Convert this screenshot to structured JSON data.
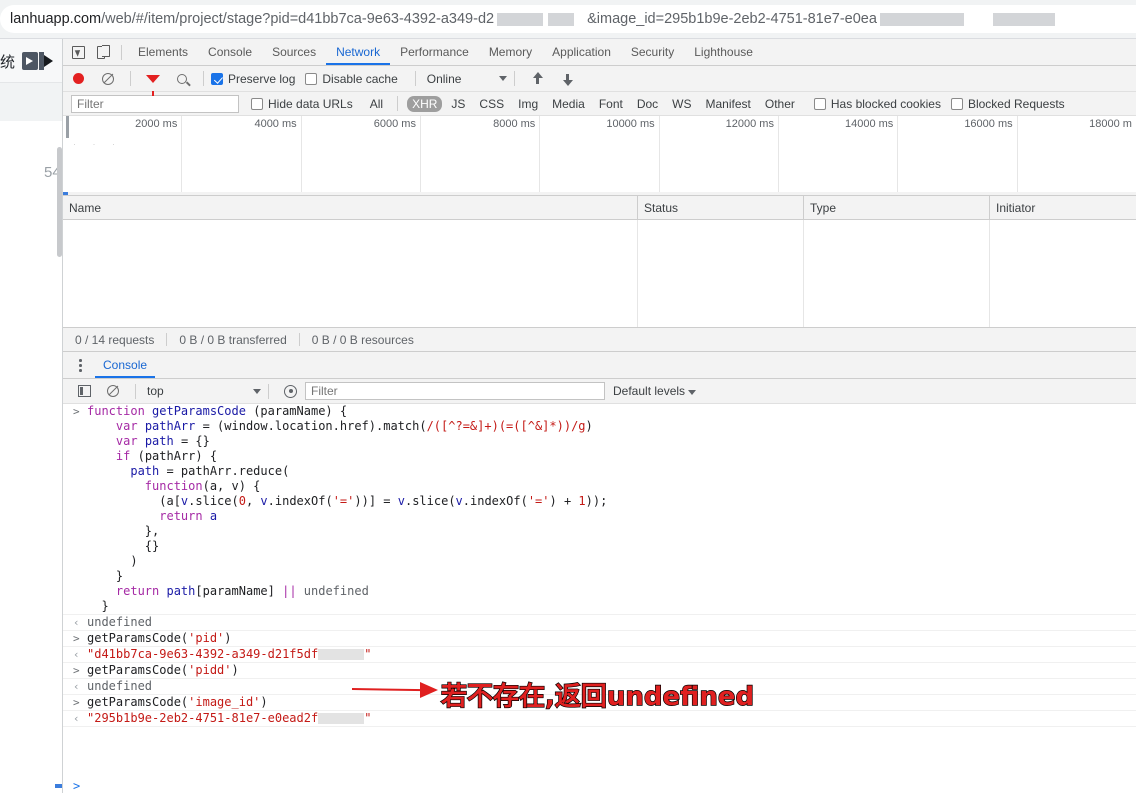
{
  "browser": {
    "url_prefix": "lanhuapp.com",
    "url_path": "/web/#/item/project/stage?pid=d41bb7ca-9e63-4392-a349-d2",
    "url_middle": "&image_id=295b1b9e-2eb2-4751-81e7-e0ea"
  },
  "page_behind": {
    "cn_fragment": "统",
    "line_number": "54"
  },
  "devtools": {
    "tabs": [
      {
        "label": "Elements",
        "active": false
      },
      {
        "label": "Console",
        "active": false
      },
      {
        "label": "Sources",
        "active": false
      },
      {
        "label": "Network",
        "active": true
      },
      {
        "label": "Performance",
        "active": false
      },
      {
        "label": "Memory",
        "active": false
      },
      {
        "label": "Application",
        "active": false
      },
      {
        "label": "Security",
        "active": false
      },
      {
        "label": "Lighthouse",
        "active": false
      }
    ],
    "icons": {
      "inspect": "inspect-element-icon",
      "device": "device-toolbar-icon"
    }
  },
  "network_toolbar": {
    "record_label": "record-button",
    "clear_label": "clear-button",
    "filter_label": "filter-button",
    "search_label": "search-button",
    "preserve_log": {
      "label": "Preserve log",
      "checked": true
    },
    "disable_cache": {
      "label": "Disable cache",
      "checked": false
    },
    "throttling": "Online",
    "import_label": "import-har-button",
    "export_label": "export-har-button"
  },
  "filter_row": {
    "filter_placeholder": "Filter",
    "filter_value": "",
    "hide_data_urls": {
      "label": "Hide data URLs",
      "checked": false
    },
    "types": [
      {
        "label": "All",
        "selected": false
      },
      {
        "label": "XHR",
        "selected": true
      },
      {
        "label": "JS",
        "selected": false
      },
      {
        "label": "CSS",
        "selected": false
      },
      {
        "label": "Img",
        "selected": false
      },
      {
        "label": "Media",
        "selected": false
      },
      {
        "label": "Font",
        "selected": false
      },
      {
        "label": "Doc",
        "selected": false
      },
      {
        "label": "WS",
        "selected": false
      },
      {
        "label": "Manifest",
        "selected": false
      },
      {
        "label": "Other",
        "selected": false
      }
    ],
    "has_blocked_cookies": {
      "label": "Has blocked cookies",
      "checked": false
    },
    "blocked_requests": {
      "label": "Blocked Requests",
      "checked": false
    }
  },
  "overview": {
    "ticks": [
      "2000 ms",
      "4000 ms",
      "6000 ms",
      "8000 ms",
      "10000 ms",
      "12000 ms",
      "14000 ms",
      "16000 ms",
      "18000 m"
    ]
  },
  "network_table": {
    "columns": [
      "Name",
      "Status",
      "Type",
      "Initiator"
    ],
    "rows": []
  },
  "network_status": {
    "requests": "0 / 14 requests",
    "transferred": "0 B / 0 B transferred",
    "resources": "0 B / 0 B resources"
  },
  "drawer": {
    "tab_label": "Console",
    "menu_icon": "kebab-menu-icon",
    "toolbar": {
      "sidebar_icon": "console-sidebar-icon",
      "clear_icon": "clear-console-icon",
      "context": "top",
      "eye_icon": "live-expression-icon",
      "filter_placeholder": "Filter",
      "filter_value": "",
      "levels": "Default levels"
    }
  },
  "console_entries": [
    {
      "kind": "input",
      "gutter": ">",
      "lines": [
        [
          {
            "t": "function ",
            "c": "kw"
          },
          {
            "t": "getParamsCode ",
            "c": "fn"
          },
          {
            "t": "(paramName) {",
            "c": "pl"
          }
        ],
        [
          {
            "t": "    ",
            "c": "pl"
          },
          {
            "t": "var ",
            "c": "kw"
          },
          {
            "t": "pathArr ",
            "c": "fn"
          },
          {
            "t": "= (window.location.href).match(",
            "c": "pl"
          },
          {
            "t": "/([^?=&]+)(=([^&]*))/g",
            "c": "re"
          },
          {
            "t": ")",
            "c": "pl"
          }
        ],
        [
          {
            "t": "    ",
            "c": "pl"
          },
          {
            "t": "var ",
            "c": "kw"
          },
          {
            "t": "path ",
            "c": "fn"
          },
          {
            "t": "= {}",
            "c": "pl"
          }
        ],
        [
          {
            "t": "    ",
            "c": "pl"
          },
          {
            "t": "if ",
            "c": "kw"
          },
          {
            "t": "(pathArr) {",
            "c": "pl"
          }
        ],
        [
          {
            "t": "      ",
            "c": "pl"
          },
          {
            "t": "path ",
            "c": "fn"
          },
          {
            "t": "= pathArr.reduce(",
            "c": "pl"
          }
        ],
        [
          {
            "t": "        ",
            "c": "pl"
          },
          {
            "t": "function",
            "c": "kw"
          },
          {
            "t": "(a, v) {",
            "c": "pl"
          }
        ],
        [
          {
            "t": "          (a[",
            "c": "pl"
          },
          {
            "t": "v",
            "c": "fn"
          },
          {
            "t": ".slice(",
            "c": "pl"
          },
          {
            "t": "0",
            "c": "re"
          },
          {
            "t": ", ",
            "c": "pl"
          },
          {
            "t": "v",
            "c": "fn"
          },
          {
            "t": ".indexOf(",
            "c": "pl"
          },
          {
            "t": "'='",
            "c": "re"
          },
          {
            "t": "))] = ",
            "c": "pl"
          },
          {
            "t": "v",
            "c": "fn"
          },
          {
            "t": ".slice(",
            "c": "pl"
          },
          {
            "t": "v",
            "c": "fn"
          },
          {
            "t": ".indexOf(",
            "c": "pl"
          },
          {
            "t": "'='",
            "c": "re"
          },
          {
            "t": ") + ",
            "c": "pl"
          },
          {
            "t": "1",
            "c": "re"
          },
          {
            "t": "));",
            "c": "pl"
          }
        ],
        [
          {
            "t": "          ",
            "c": "pl"
          },
          {
            "t": "return ",
            "c": "kw"
          },
          {
            "t": "a",
            "c": "fn"
          }
        ],
        [
          {
            "t": "        },",
            "c": "pl"
          }
        ],
        [
          {
            "t": "        {}",
            "c": "pl"
          }
        ],
        [
          {
            "t": "      )",
            "c": "pl"
          }
        ],
        [
          {
            "t": "    }",
            "c": "pl"
          }
        ],
        [
          {
            "t": "    ",
            "c": "pl"
          },
          {
            "t": "return ",
            "c": "kw"
          },
          {
            "t": "path",
            "c": "fn"
          },
          {
            "t": "[paramName] ",
            "c": "pl"
          },
          {
            "t": "|| ",
            "c": "op"
          },
          {
            "t": "undefined",
            "c": "un"
          }
        ],
        [
          {
            "t": "  }",
            "c": "pl"
          }
        ]
      ]
    },
    {
      "kind": "output",
      "gutter": "‹",
      "lines": [
        [
          {
            "t": "undefined",
            "c": "un"
          }
        ]
      ]
    },
    {
      "kind": "input",
      "gutter": ">",
      "lines": [
        [
          {
            "t": "getParamsCode(",
            "c": "pl"
          },
          {
            "t": "'pid'",
            "c": "st"
          },
          {
            "t": ")",
            "c": "pl"
          }
        ]
      ]
    },
    {
      "kind": "output",
      "gutter": "‹",
      "redacted_after": 92,
      "lines": [
        [
          {
            "t": "\"d41bb7ca-9e63-4392-a349-d21f5df",
            "c": "st"
          },
          {
            "t": "REDACT",
            "c": "redact"
          },
          {
            "t": "\"",
            "c": "st"
          }
        ]
      ]
    },
    {
      "kind": "input",
      "gutter": ">",
      "lines": [
        [
          {
            "t": "getParamsCode(",
            "c": "pl"
          },
          {
            "t": "'pidd'",
            "c": "st"
          },
          {
            "t": ")",
            "c": "pl"
          }
        ]
      ]
    },
    {
      "kind": "output",
      "gutter": "‹",
      "lines": [
        [
          {
            "t": "undefined",
            "c": "un"
          }
        ]
      ]
    },
    {
      "kind": "input",
      "gutter": ">",
      "lines": [
        [
          {
            "t": "getParamsCode(",
            "c": "pl"
          },
          {
            "t": "'image_id'",
            "c": "st"
          },
          {
            "t": ")",
            "c": "pl"
          }
        ]
      ]
    },
    {
      "kind": "output",
      "gutter": "‹",
      "lines": [
        [
          {
            "t": "\"295b1b9e-2eb2-4751-81e7-e0ead2f",
            "c": "st"
          },
          {
            "t": "REDACT",
            "c": "redact"
          },
          {
            "t": "\"",
            "c": "st"
          }
        ]
      ]
    }
  ],
  "prompt": {
    "chevron": ">"
  },
  "annotation": {
    "text": "若不存在,返回undefined",
    "color": "#e02020",
    "outline": "#000000",
    "arrow": "red-arrow-right"
  }
}
